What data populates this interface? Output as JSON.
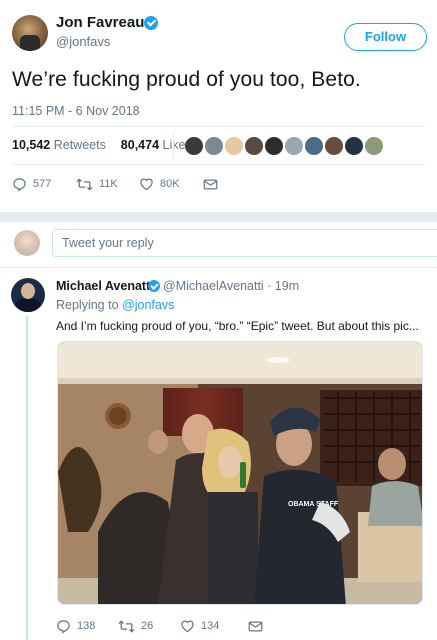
{
  "main_tweet": {
    "author_name": "Jon Favreau",
    "author_handle": "@jonfavs",
    "follow_label": "Follow",
    "text": "We’re fucking proud of you too, Beto.",
    "timestamp": "11:15 PM - 6 Nov 2018",
    "retweets_count": "10,542",
    "retweets_label": "Retweets",
    "likes_count": "80,474",
    "likes_label": "Likes",
    "actions": {
      "reply_count": "577",
      "retweet_count": "11K",
      "like_count": "80K"
    }
  },
  "reply_box": {
    "placeholder": "Tweet your reply"
  },
  "reply_tweet": {
    "author_name": "Michael Avenatti",
    "author_handle": "@MichaelAvenatti · 19m",
    "replying_prefix": "Replying to",
    "replying_to": "@jonfavs",
    "text": "And I’m fucking proud of you, “bro.” “Epic” tweet. But about this pic...",
    "photo_text": "OBAMA STAFF",
    "actions": {
      "reply_count": "138",
      "retweet_count": "26",
      "like_count": "134"
    }
  },
  "colors": {
    "brand": "#1da1f2",
    "text": "#14171a",
    "muted": "#657786",
    "border": "#e6ecf0"
  },
  "icons": [
    "verified-icon",
    "reply-icon",
    "retweet-icon",
    "like-icon",
    "message-icon"
  ]
}
